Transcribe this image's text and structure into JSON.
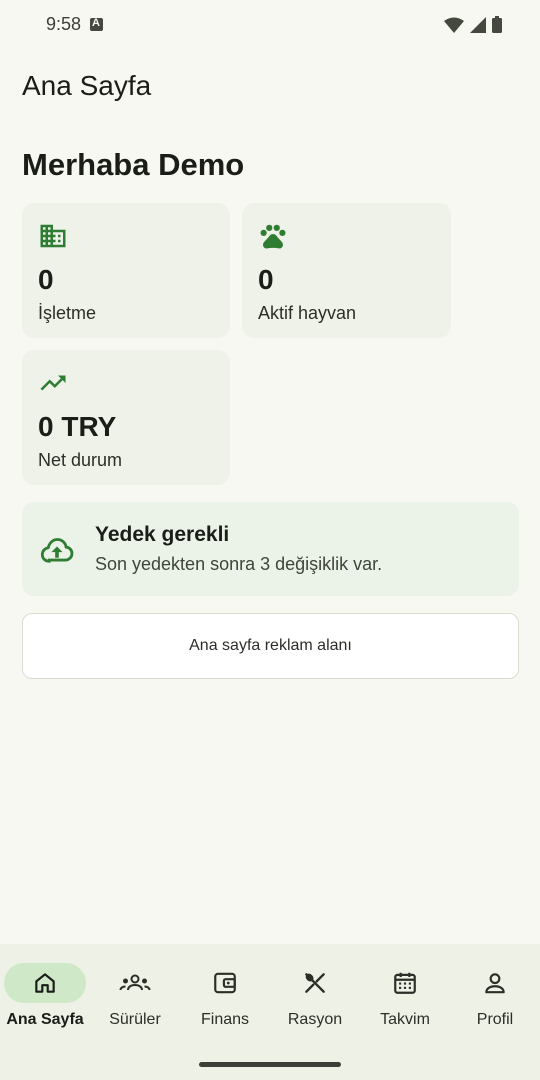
{
  "status": {
    "time": "9:58"
  },
  "header": {
    "title": "Ana Sayfa"
  },
  "greeting": "Merhaba Demo",
  "stats": [
    {
      "icon": "building-icon",
      "value": "0",
      "label": "İşletme"
    },
    {
      "icon": "paw-icon",
      "value": "0",
      "label": "Aktif hayvan"
    },
    {
      "icon": "trending-up-icon",
      "value": "0 TRY",
      "label": "Net durum"
    }
  ],
  "backup": {
    "icon": "cloud-upload-icon",
    "title": "Yedek gerekli",
    "description": "Son yedekten sonra 3 değişiklik var."
  },
  "ad": {
    "text": "Ana sayfa reklam alanı"
  },
  "nav": {
    "items": [
      {
        "label": "Ana Sayfa",
        "icon": "home-icon",
        "active": true
      },
      {
        "label": "Sürüler",
        "icon": "groups-icon",
        "active": false
      },
      {
        "label": "Finans",
        "icon": "wallet-icon",
        "active": false
      },
      {
        "label": "Rasyon",
        "icon": "utensils-icon",
        "active": false
      },
      {
        "label": "Takvim",
        "icon": "calendar-icon",
        "active": false
      },
      {
        "label": "Profil",
        "icon": "person-icon",
        "active": false
      }
    ]
  },
  "colors": {
    "accent": "#2e7d32",
    "background": "#f6f8f1",
    "card": "#eef2e8",
    "nav_active": "#cfe8c8"
  }
}
